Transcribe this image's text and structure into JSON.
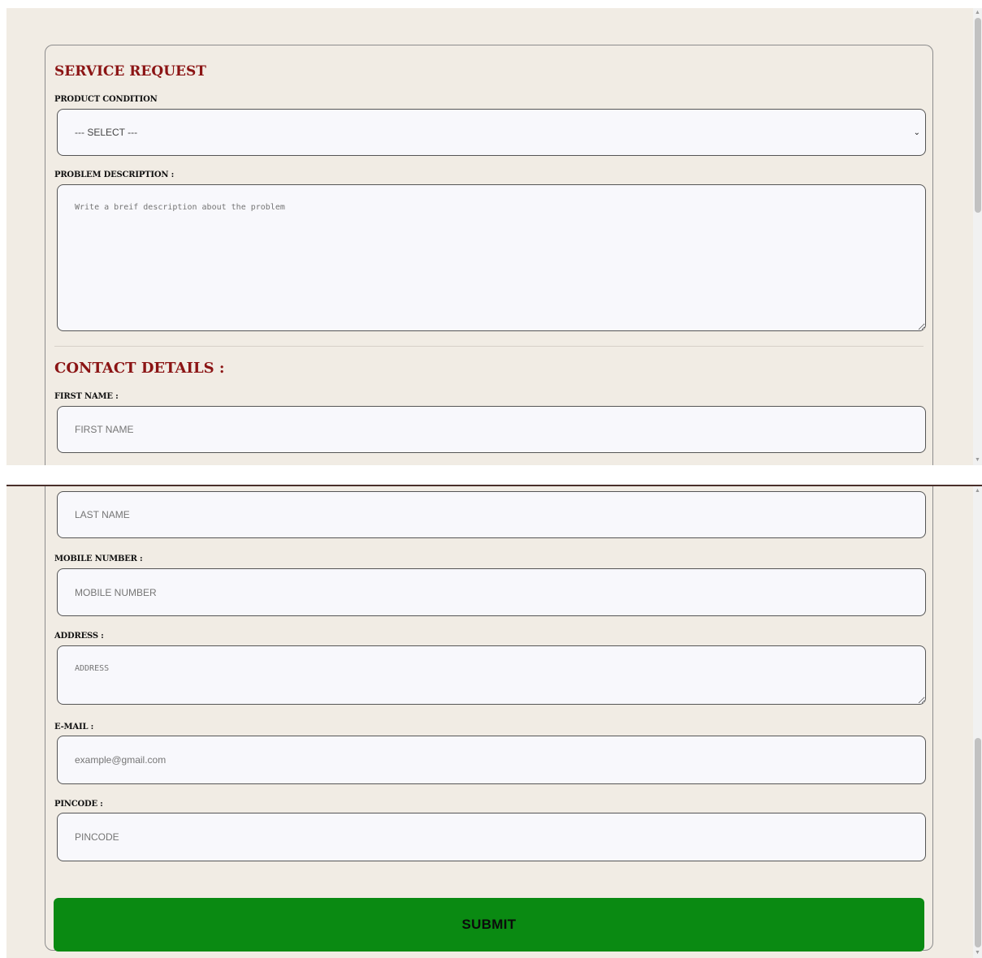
{
  "service_request": {
    "heading": "SERVICE REQUEST",
    "product_condition_label": "PRODUCT CONDITION",
    "product_condition_selected": "--- SELECT ---",
    "problem_description_label": "PROBLEM DESCRIPTION :",
    "problem_description_placeholder": "Write a breif description about the problem"
  },
  "contact_details": {
    "heading": "CONTACT DETAILS :",
    "first_name_label": "FIRST NAME :",
    "first_name_placeholder": "FIRST NAME",
    "last_name_placeholder": "LAST NAME",
    "mobile_label": "MOBILE NUMBER :",
    "mobile_placeholder": "MOBILE NUMBER",
    "address_label": "ADDRESS :",
    "address_placeholder": "ADDRESS",
    "email_label": "E-MAIL :",
    "email_placeholder": "example@gmail.com",
    "pincode_label": "PINCODE :",
    "pincode_placeholder": "PINCODE"
  },
  "submit_label": "SUBMIT",
  "colors": {
    "heading": "#8b1414",
    "page_background": "#f1ece4",
    "submit_background": "#0a8a12"
  },
  "icons": {
    "select_chevron": "chevron-down-icon",
    "scroll_up": "arrow-up-icon",
    "scroll_down": "arrow-down-icon"
  }
}
